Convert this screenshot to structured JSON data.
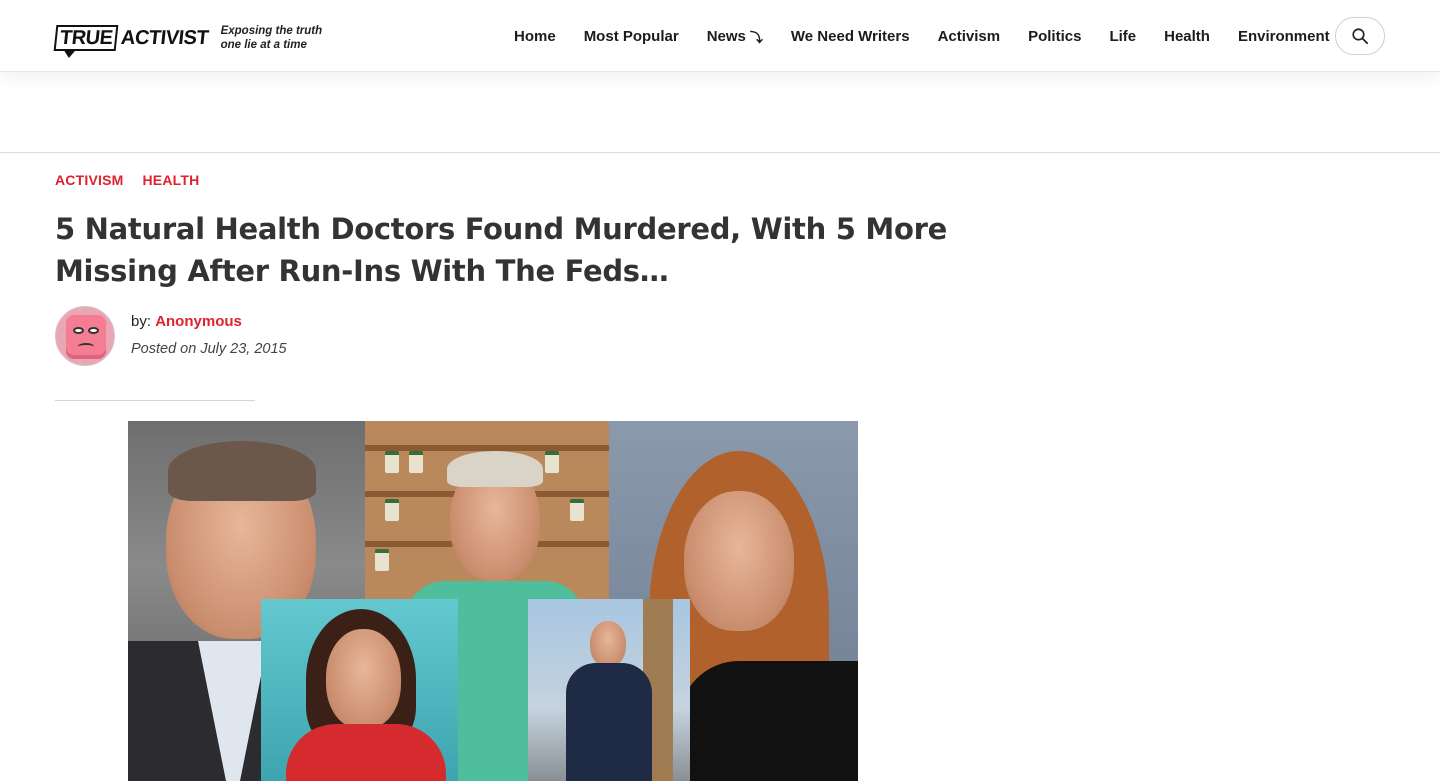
{
  "brand": {
    "logo_left": "TRUE",
    "logo_right": "ACTIVIST",
    "tagline": "Exposing the truth one lie at a time"
  },
  "nav": {
    "items": [
      {
        "label": "Home"
      },
      {
        "label": "Most Popular"
      },
      {
        "label": "News",
        "caret": "⤵"
      },
      {
        "label": "We Need Writers"
      },
      {
        "label": "Activism"
      },
      {
        "label": "Politics"
      },
      {
        "label": "Life"
      },
      {
        "label": "Health"
      },
      {
        "label": "Environment"
      }
    ],
    "search_icon": "search-icon"
  },
  "article": {
    "categories": [
      "ACTIVISM",
      "HEALTH"
    ],
    "title": "5 Natural Health Doctors Found Murdered, With 5 More Missing After Run-Ins With The Feds…",
    "author_prefix": "by:",
    "author_name": "Anonymous",
    "posted": "Posted on July 23, 2015"
  },
  "colors": {
    "accent": "#e0212e",
    "text": "#333333"
  }
}
